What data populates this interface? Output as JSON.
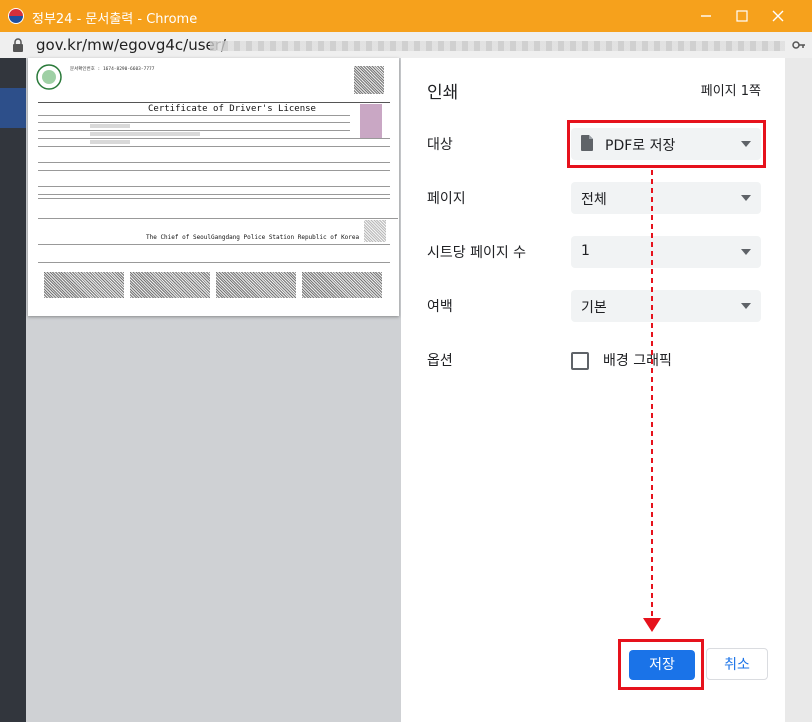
{
  "window": {
    "title": "정부24 - 문서출력 - Chrome",
    "url": "gov.kr/mw/egovg4c/user/"
  },
  "document": {
    "issue_label": "문서확인번호 : 1674-8290-6603-7777",
    "title": "Certificate of Driver's License",
    "footer": "The Chief of SeoulGangdang Police Station Republic of Korea"
  },
  "print": {
    "title": "인쇄",
    "page_count": "페이지 1쪽",
    "destination": {
      "label": "대상",
      "value": "PDF로 저장"
    },
    "pages": {
      "label": "페이지",
      "value": "전체"
    },
    "pages_per_sheet": {
      "label": "시트당 페이지 수",
      "value": "1"
    },
    "margins": {
      "label": "여백",
      "value": "기본"
    },
    "options": {
      "label": "옵션",
      "checkbox_label": "배경 그래픽"
    },
    "save_button": "저장",
    "cancel_button": "취소"
  },
  "colors": {
    "titlebar": "#f6a11c",
    "accent": "#1a73e8",
    "highlight": "#e6121c"
  }
}
